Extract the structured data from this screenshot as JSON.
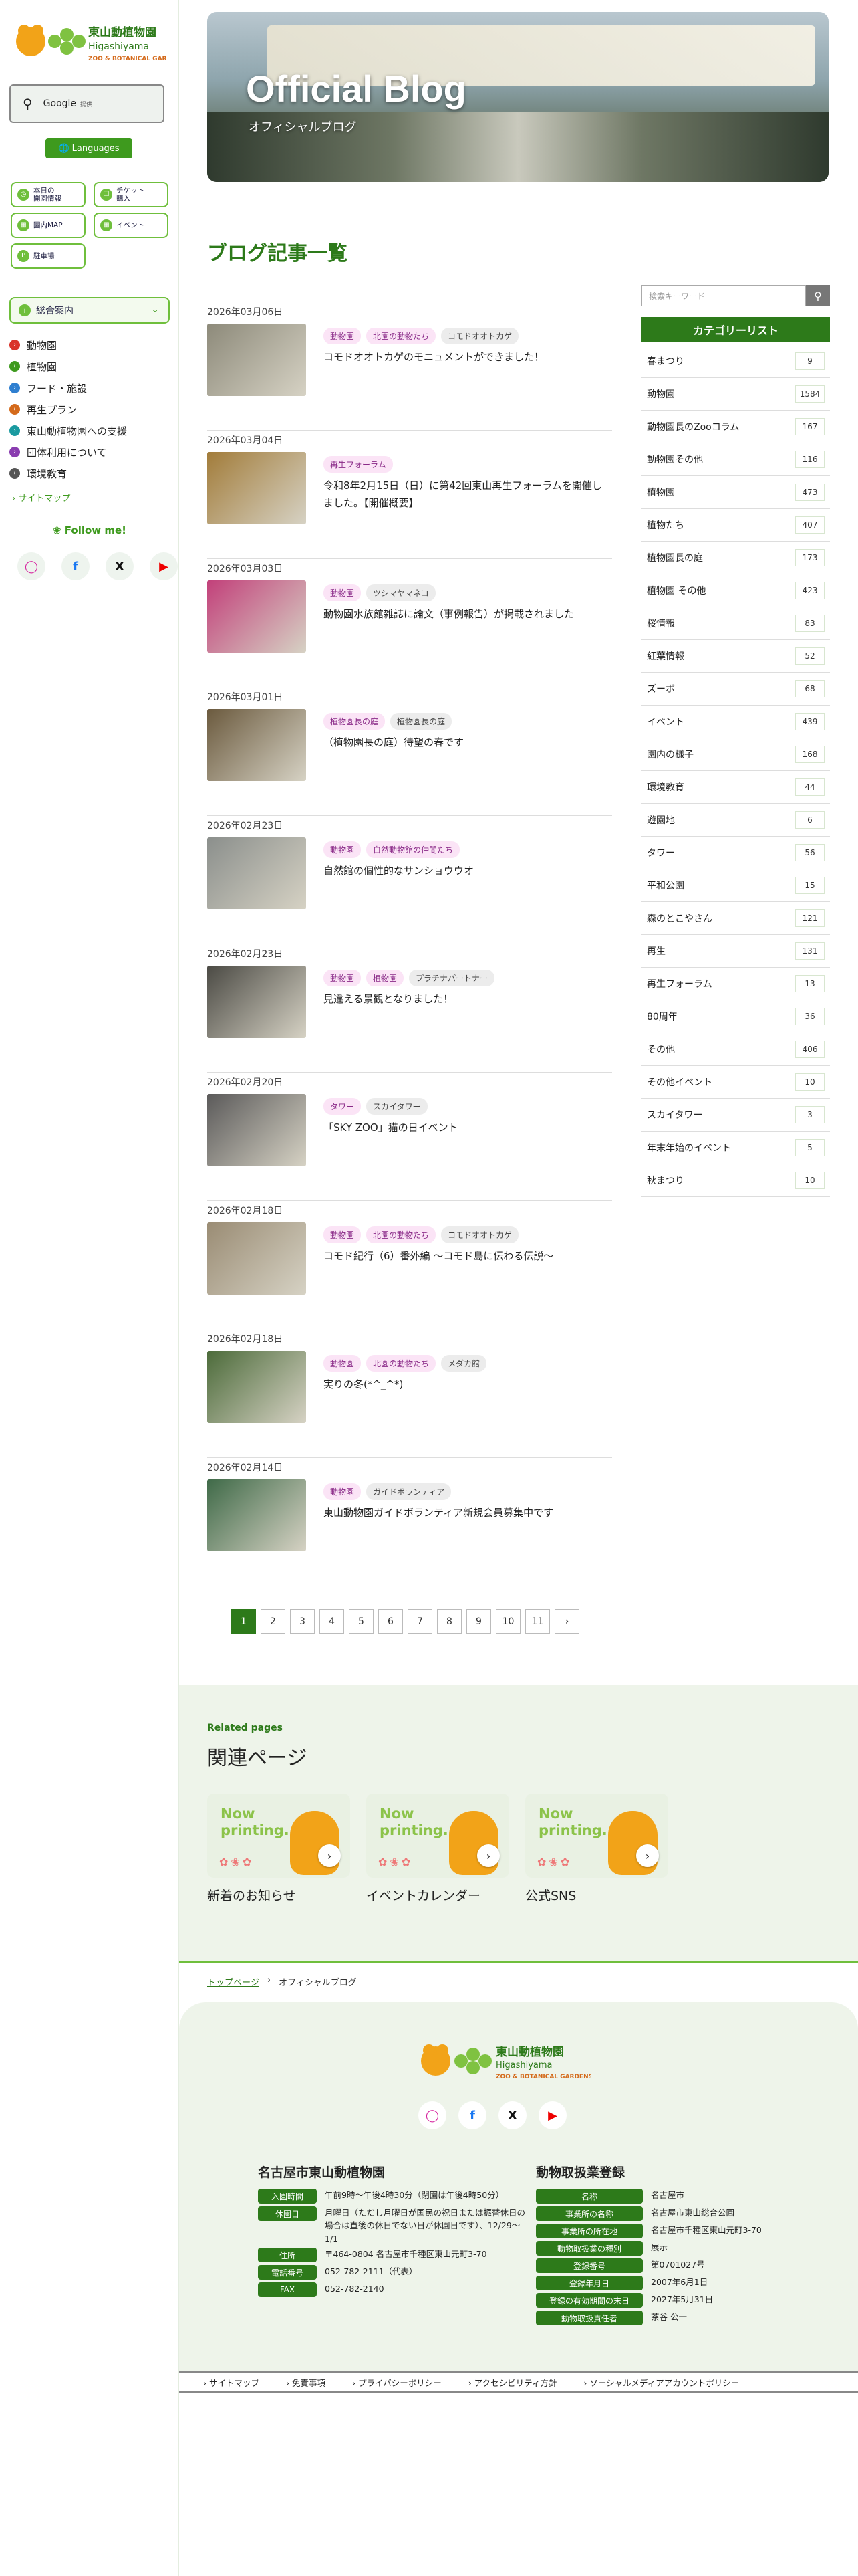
{
  "sidebar": {
    "logo_jp": "東山動植物園",
    "logo_en": "Higashiyama",
    "logo_en2": "ZOO & BOTANICAL GARDENS",
    "google_label": "Google",
    "google_small": "提供",
    "languages": "Languages",
    "quick": [
      {
        "label": "本日の\n開園情報"
      },
      {
        "label": "チケット\n購入"
      },
      {
        "label": "園内MAP"
      },
      {
        "label": "イベント"
      },
      {
        "label": "駐車場"
      }
    ],
    "accordion_label": "総合案内",
    "nav": [
      {
        "label": "動物園",
        "color": "#d9342b"
      },
      {
        "label": "植物園",
        "color": "#3e9a1e"
      },
      {
        "label": "フード・施設",
        "color": "#2f7fd0"
      },
      {
        "label": "再生プラン",
        "color": "#d46a1b"
      },
      {
        "label": "東山動植物園への支援",
        "color": "#1a9aa0"
      },
      {
        "label": "団体利用について",
        "color": "#8a3db0"
      },
      {
        "label": "環境教育",
        "color": "#555555"
      }
    ],
    "sitemap": "サイトマップ",
    "follow": "Follow me!"
  },
  "hero": {
    "title": "Official Blog",
    "subtitle": "オフィシャルブログ"
  },
  "main": {
    "heading": "ブログ記事一覧"
  },
  "posts": [
    {
      "date": "2026年03月06日",
      "tags": [
        {
          "t": "動物園",
          "c": "pink"
        },
        {
          "t": "北園の動物たち",
          "c": "pink"
        },
        {
          "t": "コモドオオトカゲ",
          "c": "grey"
        }
      ],
      "title": "コモドオオトカゲのモニュメントができました！",
      "thumb": "#8d8a7a"
    },
    {
      "date": "2026年03月04日",
      "tags": [
        {
          "t": "再生フォーラム",
          "c": "pink"
        }
      ],
      "title": "令和8年2月15日（日）に第42回東山再生フォーラムを開催しました。【開催概要】",
      "thumb": "#a27c3a"
    },
    {
      "date": "2026年03月03日",
      "tags": [
        {
          "t": "動物園",
          "c": "pink"
        },
        {
          "t": "ツシマヤマネコ",
          "c": "grey"
        }
      ],
      "title": "動物園水族館雑誌に論文（事例報告）が掲載されました",
      "thumb": "#c2407a"
    },
    {
      "date": "2026年03月01日",
      "tags": [
        {
          "t": "植物園長の庭",
          "c": "pink"
        },
        {
          "t": "植物園長の庭",
          "c": "grey"
        }
      ],
      "title": "（植物園長の庭）待望の春です",
      "thumb": "#6b5a3e"
    },
    {
      "date": "2026年02月23日",
      "tags": [
        {
          "t": "動物園",
          "c": "pink"
        },
        {
          "t": "自然動物館の仲間たち",
          "c": "pink"
        }
      ],
      "title": "自然館の個性的なサンショウウオ",
      "thumb": "#8b8f8c"
    },
    {
      "date": "2026年02月23日",
      "tags": [
        {
          "t": "動物園",
          "c": "pink"
        },
        {
          "t": "植物園",
          "c": "pink"
        },
        {
          "t": "プラチナパートナー",
          "c": "grey"
        }
      ],
      "title": "見違える景観となりました！",
      "thumb": "#4b4a44"
    },
    {
      "date": "2026年02月20日",
      "tags": [
        {
          "t": "タワー",
          "c": "pink"
        },
        {
          "t": "スカイタワー",
          "c": "grey"
        }
      ],
      "title": "「SKY ZOO」猫の日イベント",
      "thumb": "#5b5a5a"
    },
    {
      "date": "2026年02月18日",
      "tags": [
        {
          "t": "動物園",
          "c": "pink"
        },
        {
          "t": "北園の動物たち",
          "c": "pink"
        },
        {
          "t": "コモドオオトカゲ",
          "c": "grey"
        }
      ],
      "title": "コモド紀行（6）番外編 ～コモド島に伝わる伝説～",
      "thumb": "#9a8c74"
    },
    {
      "date": "2026年02月18日",
      "tags": [
        {
          "t": "動物園",
          "c": "pink"
        },
        {
          "t": "北園の動物たち",
          "c": "pink"
        },
        {
          "t": "メダカ館",
          "c": "grey"
        }
      ],
      "title": "実りの冬(*^_^*)",
      "thumb": "#4c6b3a"
    },
    {
      "date": "2026年02月14日",
      "tags": [
        {
          "t": "動物園",
          "c": "pink"
        },
        {
          "t": "ガイドボランティア",
          "c": "grey"
        }
      ],
      "title": "東山動物園ガイドボランティア新規会員募集中です",
      "thumb": "#3f6a48"
    }
  ],
  "pager": [
    "1",
    "2",
    "3",
    "4",
    "5",
    "6",
    "7",
    "8",
    "9",
    "10",
    "11",
    "›"
  ],
  "search": {
    "placeholder": "検索キーワード"
  },
  "categories": {
    "heading": "カテゴリーリスト",
    "items": [
      {
        "name": "春まつり",
        "count": "9"
      },
      {
        "name": "動物園",
        "count": "1584"
      },
      {
        "name": "動物園長のZooコラム",
        "count": "167"
      },
      {
        "name": "動物園その他",
        "count": "116"
      },
      {
        "name": "植物園",
        "count": "473"
      },
      {
        "name": "植物たち",
        "count": "407"
      },
      {
        "name": "植物園長の庭",
        "count": "173"
      },
      {
        "name": "植物園 その他",
        "count": "423"
      },
      {
        "name": "桜情報",
        "count": "83"
      },
      {
        "name": "紅葉情報",
        "count": "52"
      },
      {
        "name": "ズーボ",
        "count": "68"
      },
      {
        "name": "イベント",
        "count": "439"
      },
      {
        "name": "園内の様子",
        "count": "168"
      },
      {
        "name": "環境教育",
        "count": "44"
      },
      {
        "name": "遊園地",
        "count": "6"
      },
      {
        "name": "タワー",
        "count": "56"
      },
      {
        "name": "平和公園",
        "count": "15"
      },
      {
        "name": "森のとこやさん",
        "count": "121"
      },
      {
        "name": "再生",
        "count": "131"
      },
      {
        "name": "再生フォーラム",
        "count": "13"
      },
      {
        "name": "80周年",
        "count": "36"
      },
      {
        "name": "その他",
        "count": "406"
      },
      {
        "name": "その他イベント",
        "count": "10"
      },
      {
        "name": "スカイタワー",
        "count": "3"
      },
      {
        "name": "年末年始のイベント",
        "count": "5"
      },
      {
        "name": "秋まつり",
        "count": "10"
      }
    ]
  },
  "related": {
    "en": "Related pages",
    "jp": "関連ページ",
    "now_printing": "Now\nprinting...",
    "cards": [
      {
        "label": "新着のお知らせ"
      },
      {
        "label": "イベントカレンダー"
      },
      {
        "label": "公式SNS"
      }
    ]
  },
  "breadcrumb": {
    "home": "トップページ",
    "current": "オフィシャルブログ"
  },
  "footer": {
    "left_heading": "名古屋市東山動植物園",
    "left_rows": [
      {
        "k": "入園時間",
        "v": "午前9時〜午後4時30分（閉園は午後4時50分）"
      },
      {
        "k": "休園日",
        "v": "月曜日（ただし月曜日が国民の祝日または振替休日の場合は直後の休日でない日が休園日です）、12/29〜1/1"
      },
      {
        "k": "住所",
        "v": "〒464-0804 名古屋市千種区東山元町3-70"
      },
      {
        "k": "電話番号",
        "v": "052-782-2111（代表）"
      },
      {
        "k": "FAX",
        "v": "052-782-2140"
      }
    ],
    "right_heading": "動物取扱業登録",
    "right_rows": [
      {
        "k": "名称",
        "v": "名古屋市"
      },
      {
        "k": "事業所の名称",
        "v": "名古屋市東山総合公園"
      },
      {
        "k": "事業所の所在地",
        "v": "名古屋市千種区東山元町3-70"
      },
      {
        "k": "動物取扱業の種別",
        "v": "展示"
      },
      {
        "k": "登録番号",
        "v": "第0701027号"
      },
      {
        "k": "登録年月日",
        "v": "2007年6月1日"
      },
      {
        "k": "登録の有効期間の末日",
        "v": "2027年5月31日"
      },
      {
        "k": "動物取扱責任者",
        "v": "茶谷 公一"
      }
    ],
    "links": [
      "サイトマップ",
      "免責事項",
      "プライバシーポリシー",
      "アクセシビリティ方針",
      "ソーシャルメディアアカウントポリシー"
    ]
  },
  "colors": {
    "brand_green": "#2d7a1a",
    "accent_green": "#6fbf3c",
    "tag_pink": "#fbe4f6"
  }
}
